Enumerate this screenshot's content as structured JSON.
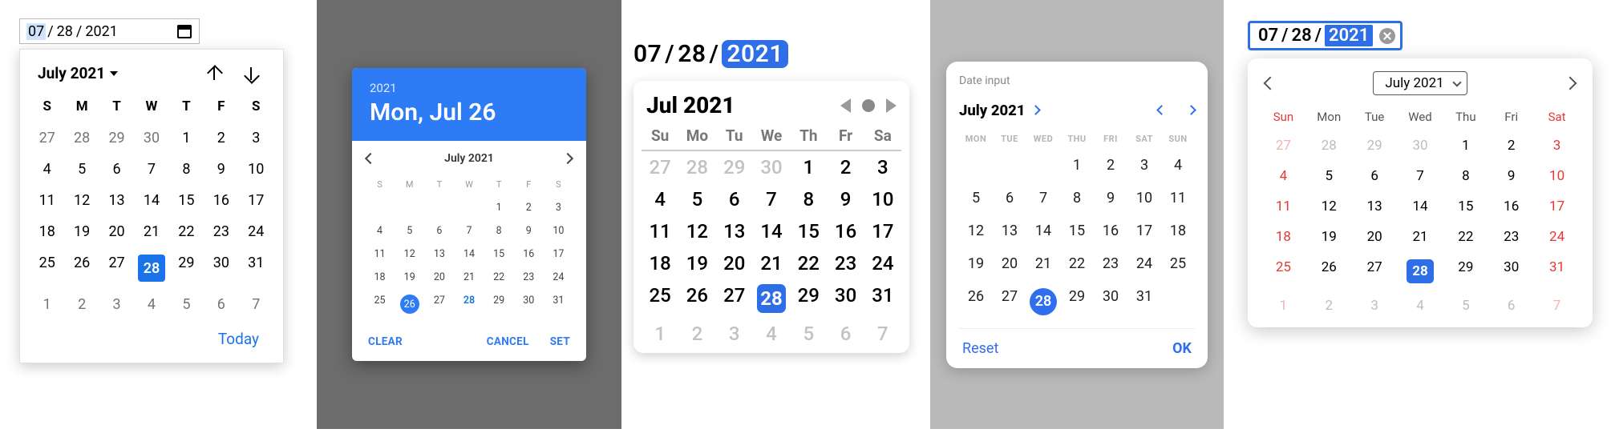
{
  "panel1": {
    "input": {
      "month": "07",
      "day": "28",
      "year": "2021",
      "selected_segment": "month"
    },
    "header": {
      "title": "July 2021"
    },
    "dow": [
      "S",
      "M",
      "T",
      "W",
      "T",
      "F",
      "S"
    ],
    "weeks": [
      [
        {
          "n": 27,
          "out": true
        },
        {
          "n": 28,
          "out": true
        },
        {
          "n": 29,
          "out": true
        },
        {
          "n": 30,
          "out": true
        },
        {
          "n": 1
        },
        {
          "n": 2
        },
        {
          "n": 3
        }
      ],
      [
        {
          "n": 4
        },
        {
          "n": 5
        },
        {
          "n": 6
        },
        {
          "n": 7
        },
        {
          "n": 8
        },
        {
          "n": 9
        },
        {
          "n": 10
        }
      ],
      [
        {
          "n": 11
        },
        {
          "n": 12
        },
        {
          "n": 13
        },
        {
          "n": 14
        },
        {
          "n": 15
        },
        {
          "n": 16
        },
        {
          "n": 17
        }
      ],
      [
        {
          "n": 18
        },
        {
          "n": 19
        },
        {
          "n": 20
        },
        {
          "n": 21
        },
        {
          "n": 22
        },
        {
          "n": 23
        },
        {
          "n": 24
        }
      ],
      [
        {
          "n": 25
        },
        {
          "n": 26
        },
        {
          "n": 27
        },
        {
          "n": 28,
          "sel": true
        },
        {
          "n": 29
        },
        {
          "n": 30
        },
        {
          "n": 31
        }
      ],
      [
        {
          "n": 1,
          "out": true
        },
        {
          "n": 2,
          "out": true
        },
        {
          "n": 3,
          "out": true
        },
        {
          "n": 4,
          "out": true
        },
        {
          "n": 5,
          "out": true
        },
        {
          "n": 6,
          "out": true
        },
        {
          "n": 7,
          "out": true
        }
      ]
    ],
    "today": "Today"
  },
  "panel2": {
    "year": "2021",
    "date_line": "Mon, Jul 26",
    "nav_title": "July 2021",
    "dow": [
      "S",
      "M",
      "T",
      "W",
      "T",
      "F",
      "S"
    ],
    "weeks": [
      [
        null,
        null,
        null,
        null,
        {
          "n": 1
        },
        {
          "n": 2
        },
        {
          "n": 3
        }
      ],
      [
        {
          "n": 4
        },
        {
          "n": 5
        },
        {
          "n": 6
        },
        {
          "n": 7
        },
        {
          "n": 8
        },
        {
          "n": 9
        },
        {
          "n": 10
        }
      ],
      [
        {
          "n": 11
        },
        {
          "n": 12
        },
        {
          "n": 13
        },
        {
          "n": 14
        },
        {
          "n": 15
        },
        {
          "n": 16
        },
        {
          "n": 17
        }
      ],
      [
        {
          "n": 18
        },
        {
          "n": 19
        },
        {
          "n": 20
        },
        {
          "n": 21
        },
        {
          "n": 22
        },
        {
          "n": 23
        },
        {
          "n": 24
        }
      ],
      [
        {
          "n": 25
        },
        {
          "n": 26,
          "sel": true
        },
        {
          "n": 27
        },
        {
          "n": 28,
          "cur": true
        },
        {
          "n": 29
        },
        {
          "n": 30
        },
        {
          "n": 31
        }
      ]
    ],
    "clear": "CLEAR",
    "cancel": "CANCEL",
    "set": "SET"
  },
  "panel3": {
    "input": {
      "month": "07",
      "day": "28",
      "year": "2021",
      "selected_segment": "year"
    },
    "title": "Jul 2021",
    "dow": [
      "Su",
      "Mo",
      "Tu",
      "We",
      "Th",
      "Fr",
      "Sa"
    ],
    "weeks": [
      [
        {
          "n": 27,
          "out": true
        },
        {
          "n": 28,
          "out": true
        },
        {
          "n": 29,
          "out": true
        },
        {
          "n": 30,
          "out": true
        },
        {
          "n": 1
        },
        {
          "n": 2
        },
        {
          "n": 3
        }
      ],
      [
        {
          "n": 4
        },
        {
          "n": 5
        },
        {
          "n": 6
        },
        {
          "n": 7
        },
        {
          "n": 8
        },
        {
          "n": 9
        },
        {
          "n": 10
        }
      ],
      [
        {
          "n": 11
        },
        {
          "n": 12
        },
        {
          "n": 13
        },
        {
          "n": 14
        },
        {
          "n": 15
        },
        {
          "n": 16
        },
        {
          "n": 17
        }
      ],
      [
        {
          "n": 18
        },
        {
          "n": 19
        },
        {
          "n": 20
        },
        {
          "n": 21
        },
        {
          "n": 22
        },
        {
          "n": 23
        },
        {
          "n": 24
        }
      ],
      [
        {
          "n": 25
        },
        {
          "n": 26
        },
        {
          "n": 27
        },
        {
          "n": 28,
          "sel": true
        },
        {
          "n": 29
        },
        {
          "n": 30
        },
        {
          "n": 31
        }
      ],
      [
        {
          "n": 1,
          "out": true
        },
        {
          "n": 2,
          "out": true
        },
        {
          "n": 3,
          "out": true
        },
        {
          "n": 4,
          "out": true
        },
        {
          "n": 5,
          "out": true
        },
        {
          "n": 6,
          "out": true
        },
        {
          "n": 7,
          "out": true
        }
      ]
    ]
  },
  "panel4": {
    "label": "Date input",
    "title": "July 2021",
    "dow": [
      "MON",
      "TUE",
      "WED",
      "THU",
      "FRI",
      "SAT",
      "SUN"
    ],
    "weeks": [
      [
        null,
        null,
        null,
        {
          "n": 1
        },
        {
          "n": 2
        },
        {
          "n": 3
        },
        {
          "n": 4
        }
      ],
      [
        {
          "n": 5
        },
        {
          "n": 6
        },
        {
          "n": 7
        },
        {
          "n": 8
        },
        {
          "n": 9
        },
        {
          "n": 10
        },
        {
          "n": 11
        }
      ],
      [
        {
          "n": 12
        },
        {
          "n": 13
        },
        {
          "n": 14
        },
        {
          "n": 15
        },
        {
          "n": 16
        },
        {
          "n": 17
        },
        {
          "n": 18
        }
      ],
      [
        {
          "n": 19
        },
        {
          "n": 20
        },
        {
          "n": 21
        },
        {
          "n": 22
        },
        {
          "n": 23
        },
        {
          "n": 24
        },
        {
          "n": 25
        }
      ],
      [
        {
          "n": 26
        },
        {
          "n": 27
        },
        {
          "n": 28,
          "sel": true
        },
        {
          "n": 29
        },
        {
          "n": 30
        },
        {
          "n": 31
        },
        null
      ]
    ],
    "reset": "Reset",
    "ok": "OK"
  },
  "panel5": {
    "input": {
      "month": "07",
      "day": "28",
      "year": "2021",
      "selected_segment": "year"
    },
    "title": "July 2021",
    "dow": [
      "Sun",
      "Mon",
      "Tue",
      "Wed",
      "Thu",
      "Fri",
      "Sat"
    ],
    "weeks": [
      [
        {
          "n": 27,
          "out": true,
          "wk": true
        },
        {
          "n": 28,
          "out": true
        },
        {
          "n": 29,
          "out": true
        },
        {
          "n": 30,
          "out": true
        },
        {
          "n": 1
        },
        {
          "n": 2
        },
        {
          "n": 3,
          "wk": true
        }
      ],
      [
        {
          "n": 4,
          "wk": true
        },
        {
          "n": 5
        },
        {
          "n": 6
        },
        {
          "n": 7
        },
        {
          "n": 8
        },
        {
          "n": 9
        },
        {
          "n": 10,
          "wk": true
        }
      ],
      [
        {
          "n": 11,
          "wk": true
        },
        {
          "n": 12
        },
        {
          "n": 13
        },
        {
          "n": 14
        },
        {
          "n": 15
        },
        {
          "n": 16
        },
        {
          "n": 17,
          "wk": true
        }
      ],
      [
        {
          "n": 18,
          "wk": true
        },
        {
          "n": 19
        },
        {
          "n": 20
        },
        {
          "n": 21
        },
        {
          "n": 22
        },
        {
          "n": 23
        },
        {
          "n": 24,
          "wk": true
        }
      ],
      [
        {
          "n": 25,
          "wk": true
        },
        {
          "n": 26
        },
        {
          "n": 27
        },
        {
          "n": 28,
          "sel": true
        },
        {
          "n": 29
        },
        {
          "n": 30
        },
        {
          "n": 31,
          "wk": true
        }
      ],
      [
        {
          "n": 1,
          "out": true,
          "wk": true
        },
        {
          "n": 2,
          "out": true
        },
        {
          "n": 3,
          "out": true
        },
        {
          "n": 4,
          "out": true
        },
        {
          "n": 5,
          "out": true
        },
        {
          "n": 6,
          "out": true
        },
        {
          "n": 7,
          "out": true,
          "wk": true
        }
      ]
    ]
  }
}
